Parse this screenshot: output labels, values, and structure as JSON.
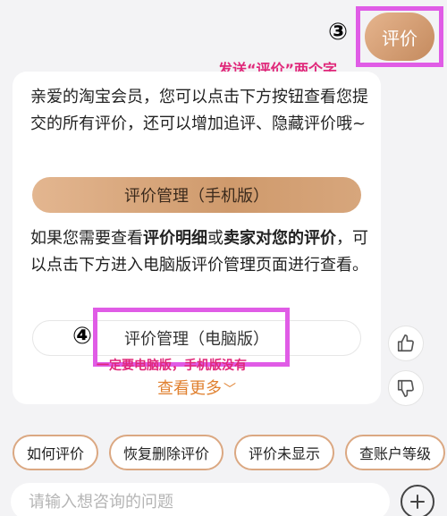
{
  "annotations": {
    "step3_num": "③",
    "step3_text": "发送“评价”两个字",
    "step4_num": "④",
    "step4_text": "一定要电脑版，手机版没有"
  },
  "user_message": "评价",
  "reply": {
    "paragraph1": "亲爱的淘宝会员，您可以点击下方按钮查看您提交的所有评价，还可以增加追评、隐藏评价哦~",
    "btn_mobile": "评价管理（手机版）",
    "p2_a": "如果您需要查看",
    "p2_b": "评价明细",
    "p2_c": "或",
    "p2_d": "卖家对您的评价",
    "p2_e": "，可以点击下方进入电脑版评价管理页面进行查看。",
    "btn_pc": "评价管理（电脑版）",
    "more": "查看更多",
    "more_chevron": "﹀"
  },
  "feedback": {
    "like_icon": "thumbs-up-icon",
    "dislike_icon": "thumbs-down-icon"
  },
  "quick_replies": [
    "如何评价",
    "恢复删除评价",
    "评价未显示",
    "查账户等级"
  ],
  "input": {
    "placeholder": "请输入想咨询的问题",
    "value": ""
  },
  "plus_icon": "plus-icon",
  "colors": {
    "accent": "#d9a37a",
    "annotation": "#e05ce6",
    "annotation_text": "#e0287a",
    "more_link": "#e0802f"
  }
}
